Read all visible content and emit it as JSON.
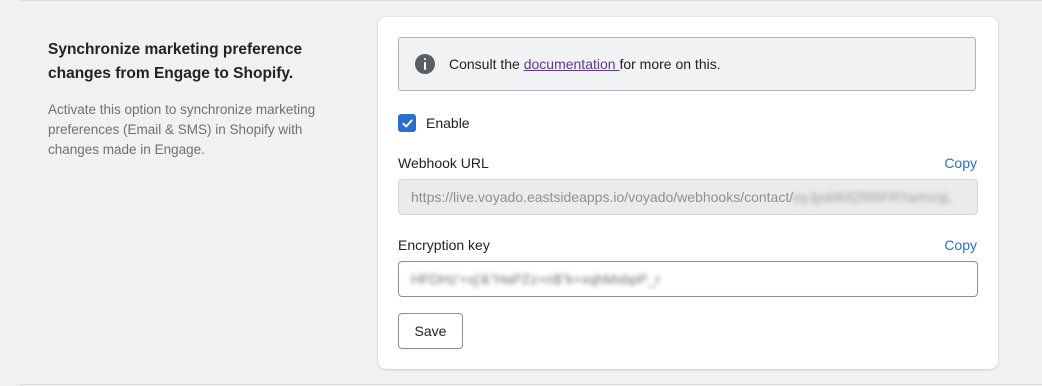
{
  "section": {
    "title": "Synchronize marketing preference changes from Engage to Shopify.",
    "description": "Activate this option to synchronize marketing preferences (Email & SMS) in Shopify with changes made in Engage."
  },
  "banner": {
    "icon": "info-icon",
    "prefix": "Consult the ",
    "link_text": "documentation ",
    "suffix": "for more on this."
  },
  "enable": {
    "label": "Enable",
    "checked": true
  },
  "webhook": {
    "label": "Webhook URL",
    "copy_label": "Copy",
    "value_visible": "https://live.voyado.eastsideapps.io/voyado/webhooks/contact/",
    "value_obscured": "eyJpdiI6IlZRRFRYamVqL"
  },
  "encryption": {
    "label": "Encryption key",
    "copy_label": "Copy",
    "value_obscured": "HFDHz'+xj'&\"HaPZz+n$\"k+xqhMxbpP_r"
  },
  "save_label": "Save",
  "colors": {
    "accent": "#2c6ecb",
    "link": "#5e3a8c",
    "background": "#f1f1f1"
  }
}
